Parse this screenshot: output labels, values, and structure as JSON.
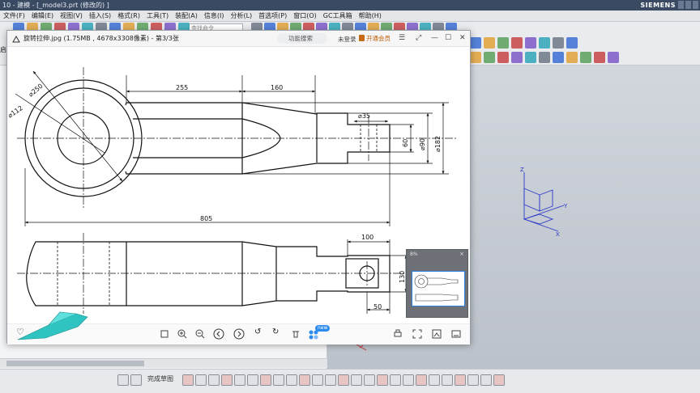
{
  "nx": {
    "title": "10 - 建模 - [_model3.prt   (修改的)   ]",
    "brand": "SIEMENS",
    "menus": [
      "文件(F)",
      "编辑(E)",
      "视图(V)",
      "插入(S)",
      "格式(R)",
      "工具(T)",
      "装配(A)",
      "信息(I)",
      "分析(L)",
      "首选项(P)",
      "窗口(O)",
      "GC工具箱",
      "帮助(H)"
    ],
    "command_search_placeholder": "查找命令",
    "left_label": "启动",
    "bottom_label": "完成草图"
  },
  "viewer": {
    "title": "旋转拉伸.jpg (1.75MB , 4678x3308像素) - 第3/3张",
    "search_label": "功能搜索",
    "login_label": "未登录",
    "vip_label": "开通会员",
    "new_badge": "new",
    "thumb_zoom": "8%"
  },
  "drawing": {
    "dims": {
      "d250": "250",
      "d112": "112",
      "len255": "255",
      "len160": "160",
      "d35": "35",
      "h60": "60",
      "d90": "90",
      "d182": "182",
      "len805": "805",
      "len100": "100",
      "h130": "130",
      "len50": "50"
    }
  },
  "axis": {
    "x": "X",
    "y": "Y",
    "z": "Z"
  },
  "colors": {
    "title_bg": "#3a4a63",
    "viewer_link": "#2e8bf0",
    "axis": "#2b39c9"
  }
}
